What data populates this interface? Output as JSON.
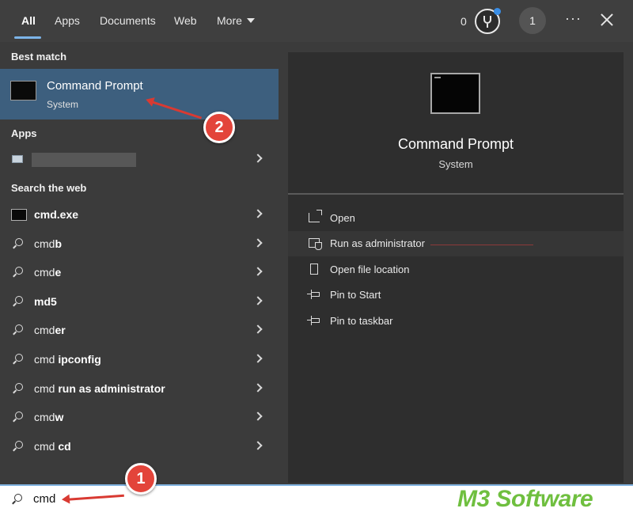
{
  "tabs": [
    {
      "label": "All",
      "active": true
    },
    {
      "label": "Apps"
    },
    {
      "label": "Documents"
    },
    {
      "label": "Web"
    },
    {
      "label": "More"
    }
  ],
  "header": {
    "reward_count": "0",
    "avatar_initial": "1",
    "more_options": "···"
  },
  "sections": {
    "best_match": "Best match",
    "apps": "Apps",
    "search_web": "Search the web"
  },
  "best_match": {
    "title": "Command Prompt",
    "subtitle": "System"
  },
  "web_results": [
    {
      "prefix": "",
      "bold": "cmd.exe",
      "icon": "cmd-icon"
    },
    {
      "prefix": "cmd",
      "bold": "b",
      "icon": "search-icon"
    },
    {
      "prefix": "cmd",
      "bold": "e",
      "icon": "search-icon"
    },
    {
      "prefix": "",
      "bold": "md5",
      "icon": "search-icon"
    },
    {
      "prefix": "cmd",
      "bold": "er",
      "icon": "search-icon"
    },
    {
      "prefix": "cmd ",
      "bold": "ipconfig",
      "icon": "search-icon"
    },
    {
      "prefix": "cmd ",
      "bold": "run as administrator",
      "icon": "search-icon"
    },
    {
      "prefix": "cmd",
      "bold": "w",
      "icon": "search-icon"
    },
    {
      "prefix": "cmd ",
      "bold": "cd",
      "icon": "search-icon"
    }
  ],
  "preview": {
    "title": "Command Prompt",
    "subtitle": "System"
  },
  "actions": [
    {
      "label": "Open",
      "icon": "open-icon"
    },
    {
      "label": "Run as administrator",
      "icon": "shield-icon"
    },
    {
      "label": "Open file location",
      "icon": "file-icon"
    },
    {
      "label": "Pin to Start",
      "icon": "pin-icon"
    },
    {
      "label": "Pin to taskbar",
      "icon": "pin-icon"
    }
  ],
  "search": {
    "query": "cmd"
  },
  "annotations": {
    "step1": "1",
    "step2": "2"
  },
  "watermark": "M3 Software",
  "colors": {
    "selection": "#3d5f7e",
    "accent": "#7cb4e8",
    "annotation": "#e3443a",
    "watermark": "#6fbf3f"
  }
}
